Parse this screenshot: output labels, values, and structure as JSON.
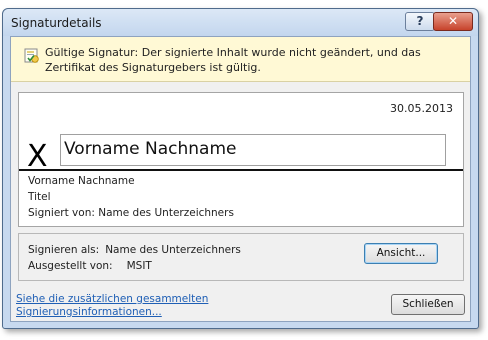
{
  "window": {
    "title": "Signaturdetails"
  },
  "titlebar": {
    "help_label": "?",
    "close_label": "✕"
  },
  "info": {
    "text": "Gültige Signatur: Der signierte Inhalt wurde nicht geändert, und das Zertifikat des Signaturgebers ist gültig."
  },
  "signature": {
    "date": "30.05.2013",
    "x_mark": "X",
    "name_in_box": "Vorname  Nachname",
    "name": "Vorname  Nachname",
    "title": "Titel",
    "signed_by_label": "Signiert von:",
    "signed_by_value": "Name des Unterzeichners"
  },
  "signer": {
    "sign_as_label": "Signieren als:",
    "sign_as_value": "Name des Unterzeichners",
    "issued_by_label": "Ausgestellt von:",
    "issued_by_value": "MSIT",
    "view_button": "Ansicht..."
  },
  "footer": {
    "link_text": "Siehe die zusätzlichen gesammelten Signierungsinformationen...",
    "close_button": "Schließen"
  }
}
